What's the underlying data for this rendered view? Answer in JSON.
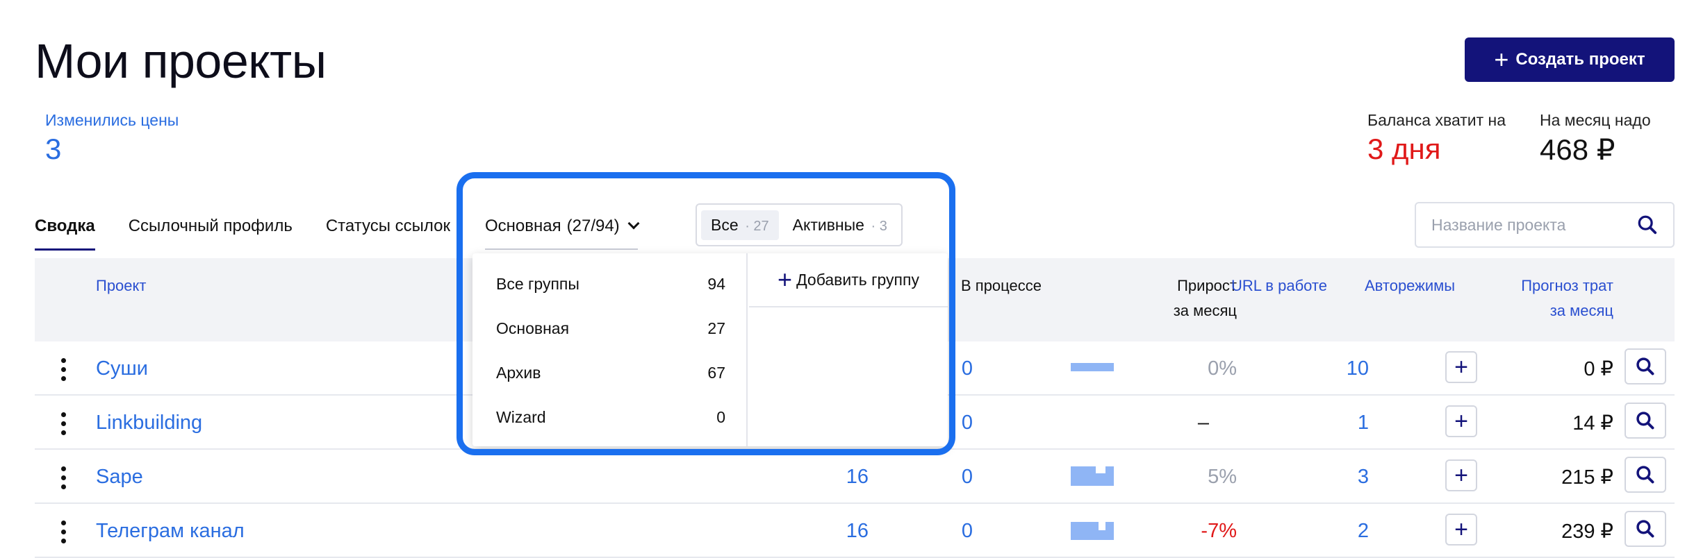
{
  "header": {
    "title": "Мои проекты",
    "create_button": "Создать проект"
  },
  "stats": {
    "prices_changed_label": "Изменились цены",
    "prices_changed_value": "3",
    "balance_label": "Баланса хватит на",
    "balance_value": "3 дня",
    "monthly_label": "На месяц надо",
    "monthly_value": "468 ₽"
  },
  "tabs": [
    "Сводка",
    "Ссылочный профиль",
    "Статусы ссылок"
  ],
  "group_select": {
    "label": "Основная",
    "count": "(27/94)"
  },
  "filter": {
    "all_label": "Все",
    "all_count": "27",
    "active_label": "Активные",
    "active_count": "3"
  },
  "search": {
    "placeholder": "Название проекта"
  },
  "dropdown": {
    "groups": [
      {
        "name": "Все группы",
        "count": "94"
      },
      {
        "name": "Основная",
        "count": "27"
      },
      {
        "name": "Архив",
        "count": "67"
      },
      {
        "name": "Wizard",
        "count": "0"
      }
    ],
    "add_group": "Добавить группу"
  },
  "columns": {
    "project": "Проект",
    "in_progress": "В процессе",
    "growth_1": "Прирост",
    "growth_2": "за месяц",
    "urls": "URL в работе",
    "automodes": "Авторежимы",
    "forecast_1": "Прогноз трат",
    "forecast_2": "за месяц"
  },
  "rows": [
    {
      "name": "Суши",
      "links": "",
      "in_progress": "0",
      "growth": "0%",
      "urls": "10",
      "forecast": "0 ₽"
    },
    {
      "name": "Linkbuilding",
      "links": "",
      "in_progress": "0",
      "growth": "–",
      "urls": "1",
      "forecast": "14 ₽"
    },
    {
      "name": "Sape",
      "links": "16",
      "in_progress": "0",
      "growth": "5%",
      "urls": "3",
      "forecast": "215 ₽"
    },
    {
      "name": "Телеграм канал",
      "links": "16",
      "in_progress": "0",
      "growth": "-7%",
      "urls": "2",
      "forecast": "239 ₽"
    }
  ],
  "colors": {
    "accent": "#13137a",
    "link": "#2a6de0",
    "negative": "#e01919",
    "highlight": "#1a6fef"
  }
}
